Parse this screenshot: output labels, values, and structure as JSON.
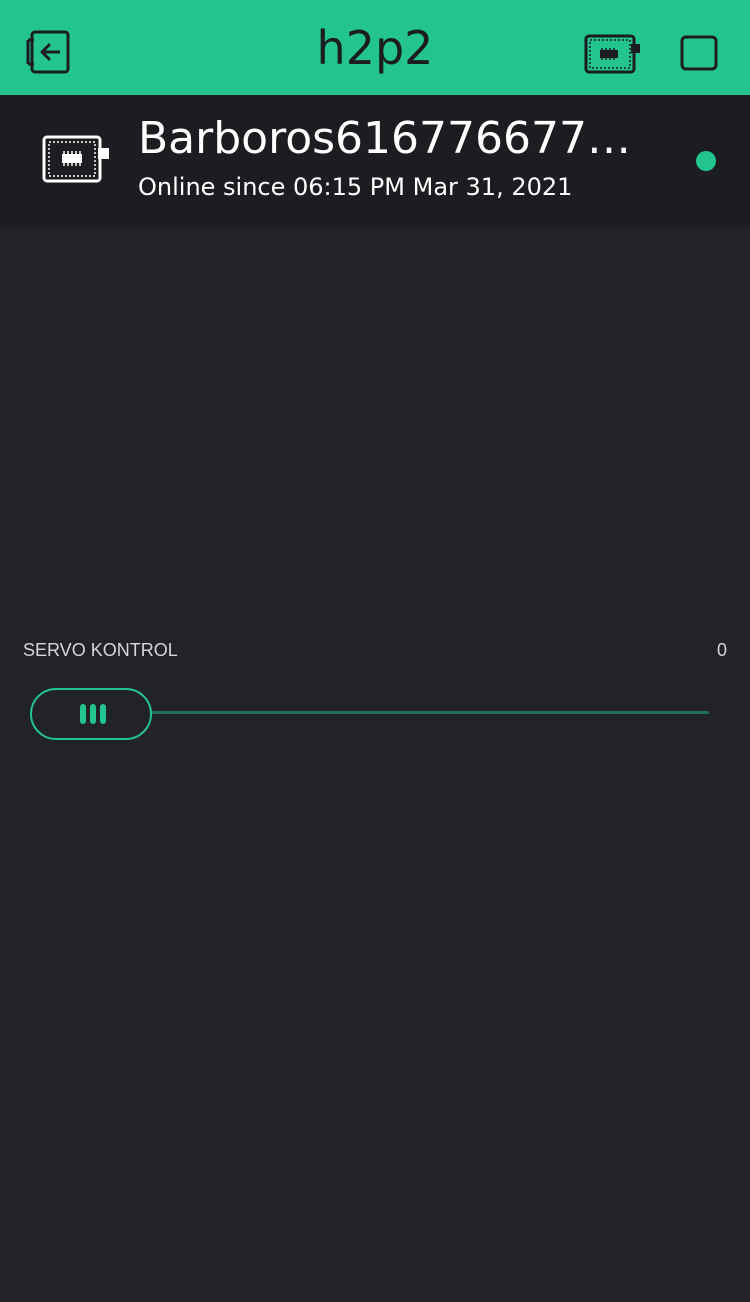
{
  "app": {
    "title": "h2p2",
    "accent_color": "#23C48E",
    "background_color": "#212328",
    "header_background_color": "#1B1D21"
  },
  "topbar": {
    "exit_icon": "exit-project-icon",
    "device_icon": "device-board-icon",
    "stop_icon": "stop-square-icon"
  },
  "device": {
    "name": "Barboros6167766776767…",
    "status_text": "Online since 06:15 PM Mar 31, 2021",
    "icon": "device-board-icon",
    "status": "online"
  },
  "slider": {
    "label": "SERVO KONTROL",
    "value": "0",
    "fill_fraction": 0.0
  }
}
